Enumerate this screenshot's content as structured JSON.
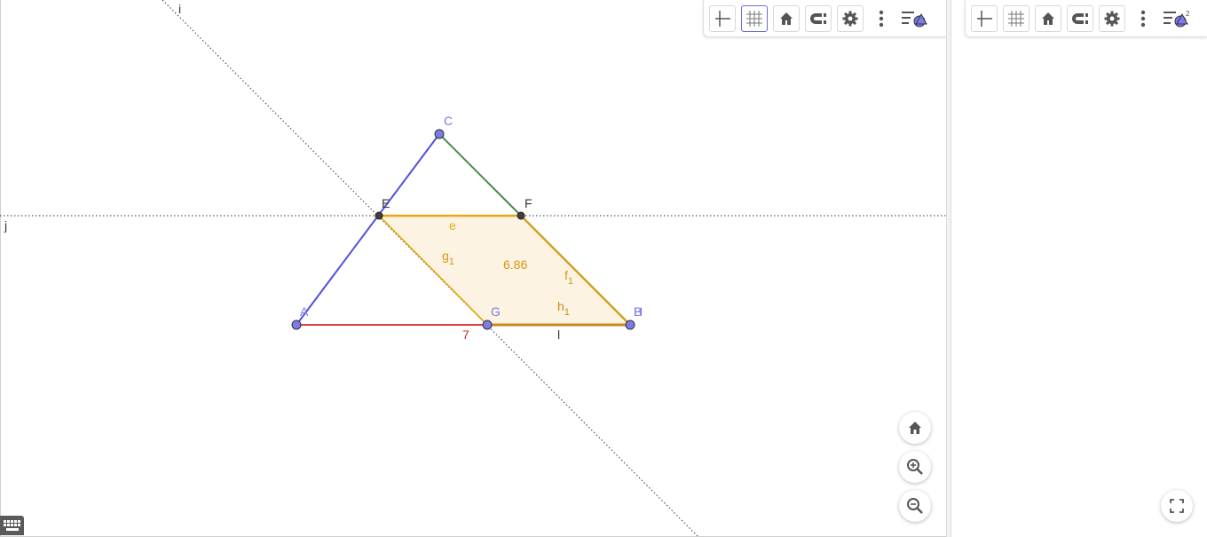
{
  "graphics": {
    "points": {
      "A": "A",
      "B": "B",
      "C": "C",
      "E": "E",
      "F": "F",
      "G": "G",
      "H": "H"
    },
    "lines": {
      "i": "i",
      "j": "j"
    },
    "labels": {
      "e": "e",
      "g": "g",
      "g_sub": "1",
      "f": "f",
      "f_sub": "1",
      "h": "h",
      "h_sub": "1",
      "l": "l",
      "area": "6.86",
      "length_AB": "7"
    },
    "colors": {
      "point_free": "#7b7bea",
      "point_dependent": "#404040",
      "segment_AC": "#5050e0",
      "segment_CB": "#4a8a4a",
      "segment_AB": "#e04040",
      "polygon": "#e6a817",
      "polygon_fill": "#fdf3e2",
      "line_dotted": "#333333"
    }
  },
  "stylebar": {
    "buttons": [
      "axes-toggle",
      "grid-toggle",
      "standard-view",
      "point-capturing",
      "settings",
      "more-menu",
      "view-menu"
    ]
  }
}
